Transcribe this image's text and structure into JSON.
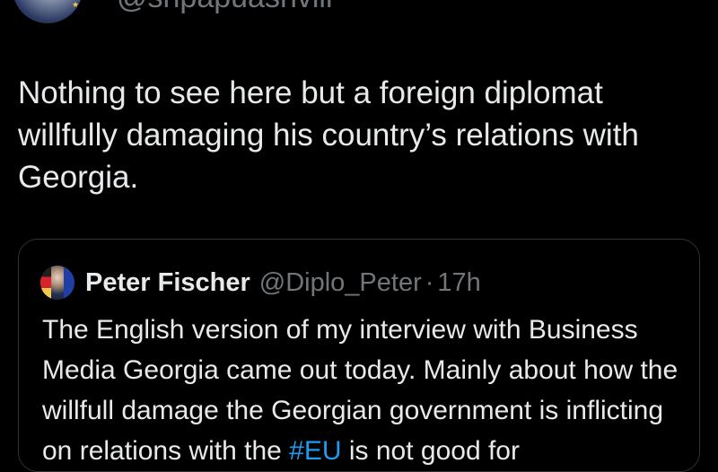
{
  "author": {
    "handle": "@shpapuashvili"
  },
  "tweet": {
    "text": "Nothing to see here but a foreign diplomat willfully damaging his country’s relations with Georgia."
  },
  "quoted_tweet": {
    "name": "Peter Fischer",
    "handle": "@Diplo_Peter",
    "separator": "·",
    "time": "17h",
    "text_before_tag": "The English version of my interview with Business Media Georgia came out today. Mainly about how the willfull damage the Georgian government is inflicting on relations with the ",
    "hashtag": "#EU",
    "text_after_tag": " is not good for"
  },
  "colors": {
    "background": "#000000",
    "text": "#e7e9ea",
    "muted": "#71767b",
    "link": "#1d9bf0",
    "border": "#2f3336"
  }
}
